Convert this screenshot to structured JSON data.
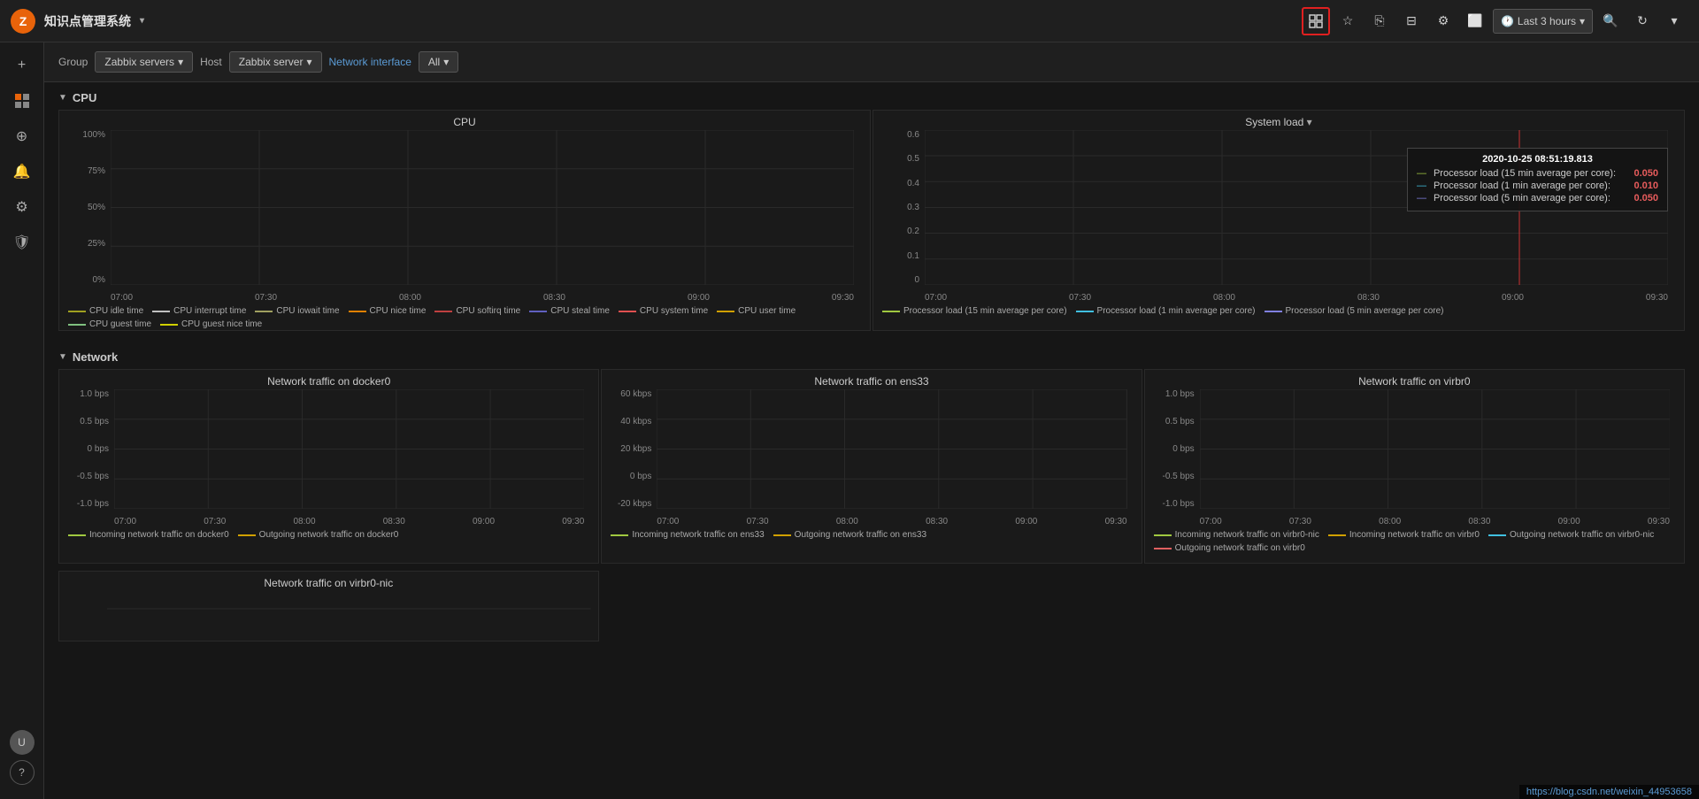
{
  "app": {
    "logo_text": "Z",
    "title": "知识点管理系统",
    "title_arrow": "▾"
  },
  "nav_icons": [
    {
      "name": "add-dashboard-icon",
      "label": "+",
      "active_red": true
    },
    {
      "name": "star-icon",
      "label": "☆"
    },
    {
      "name": "share-icon",
      "label": "⎘"
    },
    {
      "name": "tv-icon",
      "label": "⊡"
    },
    {
      "name": "settings-icon",
      "label": "⚙"
    },
    {
      "name": "monitor-icon",
      "label": "🖥"
    }
  ],
  "time_selector": {
    "label": "Last 3 hours",
    "icon": "🕐"
  },
  "sidebar_items": [
    {
      "name": "plus-icon",
      "label": "+"
    },
    {
      "name": "dashboard-icon",
      "label": "▦"
    },
    {
      "name": "discover-icon",
      "label": "⊕"
    },
    {
      "name": "alert-icon",
      "label": "🔔"
    },
    {
      "name": "config-icon",
      "label": "⚙"
    },
    {
      "name": "shield-icon",
      "label": "🛡"
    }
  ],
  "sidebar_bottom": [
    {
      "name": "user-avatar",
      "label": "U"
    },
    {
      "name": "help-icon",
      "label": "?"
    }
  ],
  "filter": {
    "group_label": "Group",
    "group_value": "Zabbix servers",
    "host_label": "Host",
    "host_value": "Zabbix server",
    "network_label": "Network interface",
    "all_label": "All"
  },
  "sections": {
    "cpu": {
      "title": "CPU",
      "collapsed": false
    },
    "network": {
      "title": "Network",
      "collapsed": false
    }
  },
  "cpu_chart": {
    "title": "CPU",
    "y_labels": [
      "100%",
      "75%",
      "50%",
      "25%",
      "0%"
    ],
    "x_labels": [
      "07:00",
      "07:30",
      "08:00",
      "08:30",
      "09:00",
      "09:30"
    ],
    "legend": [
      {
        "label": "CPU idle time",
        "color": "#a0a020",
        "dash": true
      },
      {
        "label": "CPU interrupt time",
        "color": "#c0c0c0",
        "dash": true
      },
      {
        "label": "CPU iowait time",
        "color": "#a0a060",
        "dash": true
      },
      {
        "label": "CPU nice time",
        "color": "#e08000",
        "dash": true
      },
      {
        "label": "CPU softirq time",
        "color": "#c04040",
        "dash": true
      },
      {
        "label": "CPU steal time",
        "color": "#6060c0",
        "dash": true
      },
      {
        "label": "CPU system time",
        "color": "#e05050",
        "dash": true
      },
      {
        "label": "CPU user time",
        "color": "#d0a000",
        "dash": true
      },
      {
        "label": "CPU guest time",
        "color": "#80c080",
        "dash": true
      },
      {
        "label": "CPU guest nice time",
        "color": "#d0d000",
        "dash": true
      }
    ]
  },
  "system_load_chart": {
    "title": "System load",
    "y_labels": [
      "0.6",
      "0.5",
      "0.4",
      "0.3",
      "0.2",
      "0.1",
      "0"
    ],
    "x_labels": [
      "07:00",
      "07:30",
      "08:00",
      "08:30",
      "09:00",
      "09:30"
    ],
    "tooltip": {
      "timestamp": "2020-10-25 08:51:19.813",
      "rows": [
        {
          "label": "Processor load (15 min average per core):",
          "color": "#a0c840",
          "value": "0.050"
        },
        {
          "label": "Processor load (1 min average per core):",
          "color": "#40c0e0",
          "value": "0.010"
        },
        {
          "label": "Processor load (5 min average per core):",
          "color": "#8080e0",
          "value": "0.050"
        }
      ]
    },
    "legend": [
      {
        "label": "Processor load (15 min average per core)",
        "color": "#a0c840"
      },
      {
        "label": "Processor load (1 min average per core)",
        "color": "#40c0e0"
      },
      {
        "label": "Processor load (5 min average per core)",
        "color": "#8080e0"
      }
    ]
  },
  "network_docker0": {
    "title": "Network traffic on docker0",
    "y_labels": [
      "1.0 bps",
      "0.5 bps",
      "0 bps",
      "-0.5 bps",
      "-1.0 bps"
    ],
    "x_labels": [
      "07:00",
      "07:30",
      "08:00",
      "08:30",
      "09:00",
      "09:30"
    ],
    "legend": [
      {
        "label": "Incoming network traffic on docker0",
        "color": "#a0c840"
      },
      {
        "label": "Outgoing network traffic on docker0",
        "color": "#d0a000"
      }
    ]
  },
  "network_ens33": {
    "title": "Network traffic on ens33",
    "y_labels": [
      "60 kbps",
      "40 kbps",
      "20 kbps",
      "0 bps",
      "-20 kbps"
    ],
    "x_labels": [
      "07:00",
      "07:30",
      "08:00",
      "08:30",
      "09:00",
      "09:30"
    ],
    "legend": [
      {
        "label": "Incoming network traffic on ens33",
        "color": "#a0c840"
      },
      {
        "label": "Outgoing network traffic on ens33",
        "color": "#d0a000"
      }
    ]
  },
  "network_virbr0": {
    "title": "Network traffic on virbr0",
    "y_labels": [
      "1.0 bps",
      "0.5 bps",
      "0 bps",
      "-0.5 bps",
      "-1.0 bps"
    ],
    "x_labels": [
      "07:00",
      "07:30",
      "08:00",
      "08:30",
      "09:00",
      "09:30"
    ],
    "legend": [
      {
        "label": "Incoming network traffic on virbr0-nic",
        "color": "#a0c840"
      },
      {
        "label": "Incoming network traffic on virbr0",
        "color": "#d0a000"
      },
      {
        "label": "Outgoing network traffic on virbr0-nic",
        "color": "#40c0e0"
      },
      {
        "label": "Outgoing network traffic on virbr0",
        "color": "#e06060"
      }
    ]
  },
  "network_virbr0_nic": {
    "title": "Network traffic on virbr0-nic"
  },
  "url": "https://blog.csdn.net/weixin_44953658"
}
